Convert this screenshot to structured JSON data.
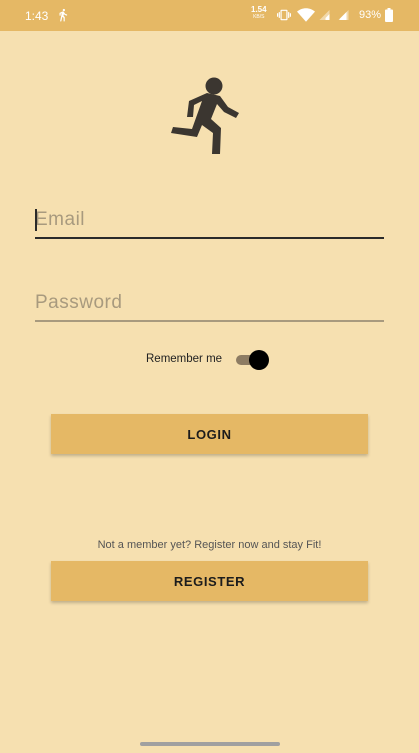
{
  "status_bar": {
    "time": "1:43",
    "net_speed": "1.54",
    "net_unit": "KB/S",
    "battery_pct": "93%"
  },
  "icons": {
    "logo": "running-person-icon",
    "status_activity": "running-person-icon",
    "vibrate": "vibrate-icon",
    "wifi": "wifi-icon",
    "signal": "cell-signal-icon",
    "battery": "battery-icon"
  },
  "form": {
    "email_placeholder": "Email",
    "email_value": "",
    "password_placeholder": "Password",
    "password_value": "",
    "remember_label": "Remember me",
    "remember_on": true
  },
  "buttons": {
    "login": "LOGIN",
    "register": "REGISTER"
  },
  "promo_text": "Not a member yet? Register now and stay Fit!",
  "colors": {
    "background": "#f6e0b0",
    "accent": "#e5b865",
    "text": "#1c1c1c"
  }
}
